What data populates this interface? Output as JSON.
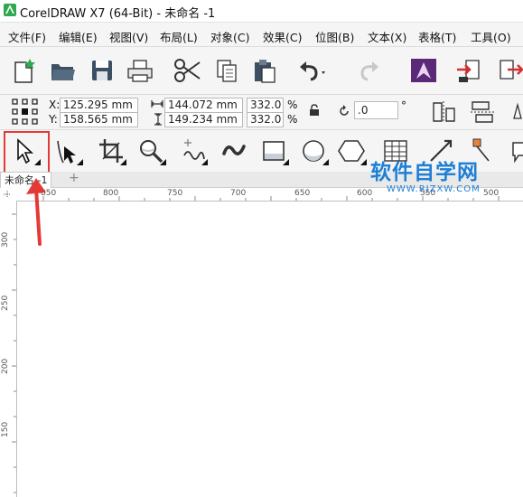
{
  "window": {
    "title": "CorelDRAW X7 (64-Bit) - 未命名 -1"
  },
  "menu": [
    {
      "label": "文件(F)"
    },
    {
      "label": "编辑(E)"
    },
    {
      "label": "视图(V)"
    },
    {
      "label": "布局(L)"
    },
    {
      "label": "对象(C)"
    },
    {
      "label": "效果(C)"
    },
    {
      "label": "位图(B)"
    },
    {
      "label": "文本(X)"
    },
    {
      "label": "表格(T)"
    },
    {
      "label": "工具(O)"
    }
  ],
  "toolbar": {
    "icons": [
      "new-document-icon",
      "open-folder-icon",
      "save-icon",
      "print-icon",
      "cut-icon",
      "copy-icon",
      "paste-icon",
      "undo-icon",
      "redo-icon",
      "application-launcher-icon",
      "import-icon",
      "export-icon"
    ]
  },
  "properties": {
    "x_label": "X:",
    "x_value": "125.295 mm",
    "y_label": "Y:",
    "y_value": "158.565 mm",
    "width_value": "144.072 mm",
    "height_value": "149.234 mm",
    "scale_x": "332.0",
    "scale_y": "332.0",
    "percent": "%",
    "rotation_value": ".0",
    "degree": "°"
  },
  "document": {
    "tab_label": "未命名 -1",
    "add_tab": "+"
  },
  "ruler": {
    "top_ticks": [
      "850",
      "800",
      "750",
      "700",
      "650",
      "600",
      "550",
      "500"
    ],
    "left_ticks": [
      "300",
      "250",
      "200",
      "150"
    ]
  },
  "watermark": {
    "text": "软件自学网",
    "url": "WWW.RJZXW.COM"
  },
  "colors": {
    "highlight": "#e53935",
    "arrow": "#e53935",
    "watermark": "#1e7fd6",
    "accent_green": "#2fa84f"
  }
}
